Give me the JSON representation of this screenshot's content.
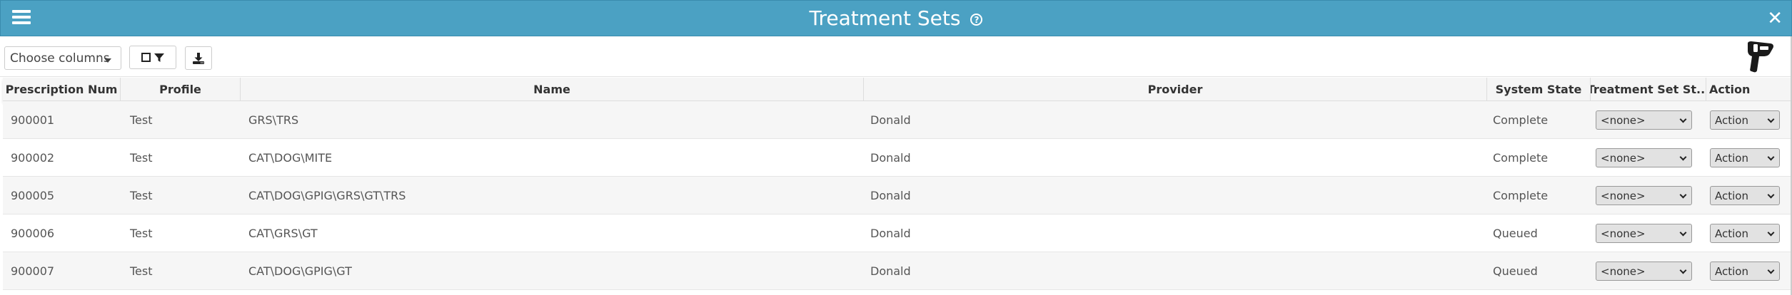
{
  "window": {
    "title": "Treatment Sets",
    "accent_color": "#4ba1c3"
  },
  "toolbar": {
    "choose_columns_label": "Choose columns",
    "filter_icon": "filter-icon",
    "download_icon": "download-icon",
    "scanner_icon": "barcode-scanner-icon"
  },
  "table": {
    "columns": [
      "Prescription Num",
      "Profile",
      "Name",
      "Provider",
      "System State",
      "Treatment Set St...",
      "Action"
    ],
    "rows": [
      {
        "prescription_num": "900001",
        "profile": "Test",
        "name": "GRS\\TRS",
        "provider": "Donald",
        "system_state": "Complete",
        "treatment_set_state": "<none>",
        "action": "Action"
      },
      {
        "prescription_num": "900002",
        "profile": "Test",
        "name": "CAT\\DOG\\MITE",
        "provider": "Donald",
        "system_state": "Complete",
        "treatment_set_state": "<none>",
        "action": "Action"
      },
      {
        "prescription_num": "900005",
        "profile": "Test",
        "name": "CAT\\DOG\\GPIG\\GRS\\GT\\TRS",
        "provider": "Donald",
        "system_state": "Complete",
        "treatment_set_state": "<none>",
        "action": "Action"
      },
      {
        "prescription_num": "900006",
        "profile": "Test",
        "name": "CAT\\GRS\\GT",
        "provider": "Donald",
        "system_state": "Queued",
        "treatment_set_state": "<none>",
        "action": "Action"
      },
      {
        "prescription_num": "900007",
        "profile": "Test",
        "name": "CAT\\DOG\\GPIG\\GT",
        "provider": "Donald",
        "system_state": "Queued",
        "treatment_set_state": "<none>",
        "action": "Action"
      }
    ]
  }
}
